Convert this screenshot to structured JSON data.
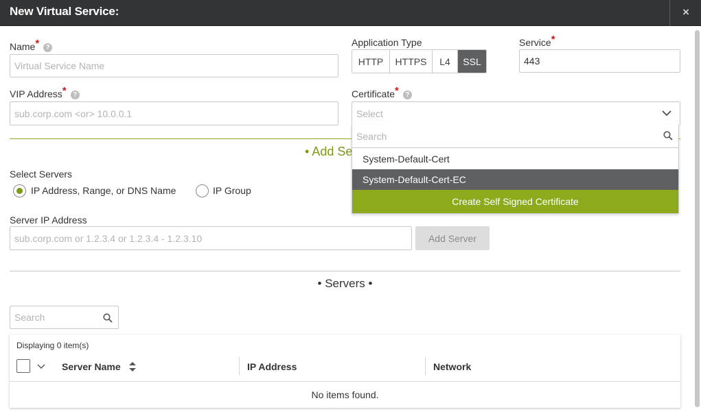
{
  "dialog": {
    "title": "New Virtual Service:",
    "close_label": "×"
  },
  "form": {
    "name": {
      "label": "Name",
      "required": "*",
      "placeholder": "Virtual Service Name",
      "value": ""
    },
    "application_type": {
      "label": "Application Type",
      "options": [
        "HTTP",
        "HTTPS",
        "L4",
        "SSL"
      ],
      "selected": "SSL"
    },
    "service": {
      "label": "Service",
      "required": "*",
      "value": "443"
    },
    "vip_address": {
      "label": "VIP Address",
      "required": "*",
      "placeholder": "sub.corp.com <or> 10.0.0.1"
    },
    "certificate": {
      "label": "Certificate",
      "required": "*",
      "placeholder": "Select",
      "dropdown": {
        "search_placeholder": "Search",
        "options": [
          "System-Default-Cert",
          "System-Default-Cert-EC"
        ],
        "highlighted": "System-Default-Cert-EC",
        "create_label": "Create Self Signed Certificate"
      }
    }
  },
  "add_servers": {
    "title": "• Add Serv",
    "select_servers_label": "Select Servers",
    "radio_ip": "IP Address, Range, or DNS Name",
    "radio_group": "IP Group",
    "selected": "IP Address, Range, or DNS Name",
    "server_ip_label": "Server IP Address",
    "server_ip_placeholder": "sub.corp.com or 1.2.3.4 or 1.2.3.4 - 1.2.3.10",
    "add_button": "Add Server"
  },
  "servers": {
    "title": "• Servers •",
    "search_placeholder": "Search",
    "displaying": "Displaying 0 item(s)",
    "columns": [
      "Server Name",
      "IP Address",
      "Network"
    ],
    "empty_text": "No items found."
  },
  "colors": {
    "accent": "#8daa1c",
    "titlebar": "#333436",
    "required": "#d01717",
    "selected_segment": "#5e5f61"
  }
}
